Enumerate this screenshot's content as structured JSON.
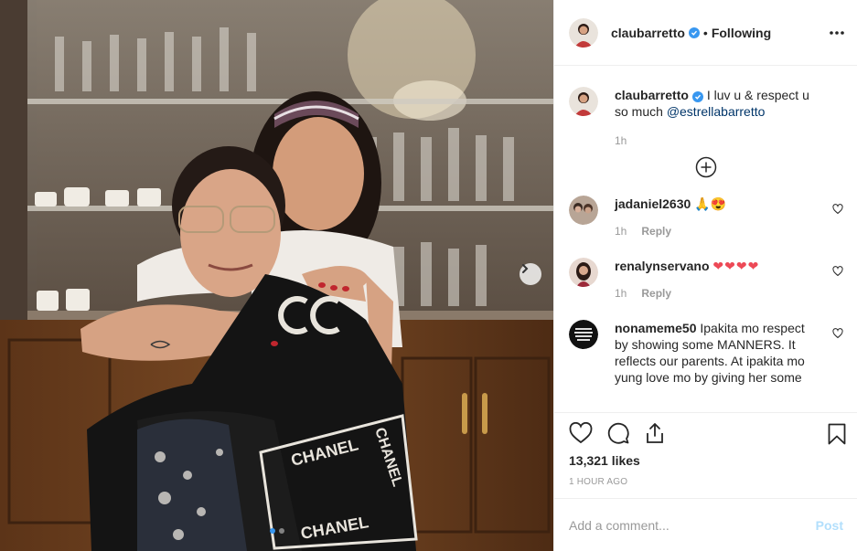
{
  "post": {
    "author": "claubarretto",
    "follow_status": "Following",
    "bullet": "•",
    "likes": "13,321 likes",
    "time_ago": "1 HOUR AGO"
  },
  "caption": {
    "username": "claubarretto",
    "text": "I luv u & respect u so much ",
    "mention": "@estrellabarretto",
    "time": "1h"
  },
  "photo": {
    "carousel_count": 2,
    "active_slide": 1,
    "scarf_text": "CHANEL"
  },
  "comments": [
    {
      "username": "jadaniel2630",
      "text": "🙏😍",
      "time": "1h",
      "reply_label": "Reply"
    },
    {
      "username": "renalynservano",
      "text": "❤❤❤❤",
      "time": "1h",
      "reply_label": "Reply"
    },
    {
      "username": "nonameme50",
      "text": "Ipakita mo respect by showing some MANNERS. It reflects our parents. At ipakita mo yung love mo by giving her some",
      "time": "",
      "reply_label": ""
    }
  ],
  "comment_input": {
    "placeholder": "Add a comment...",
    "post_label": "Post"
  },
  "colors": {
    "link": "#003569",
    "accent": "#3897f0",
    "muted": "#999999",
    "post_disabled": "#b2dffc",
    "heart_red": "#ed4956"
  },
  "icons": [
    "verified-icon",
    "more-options-icon",
    "load-more-comments-icon",
    "heart-icon",
    "comment-icon",
    "share-icon",
    "bookmark-icon",
    "next-arrow-icon"
  ]
}
